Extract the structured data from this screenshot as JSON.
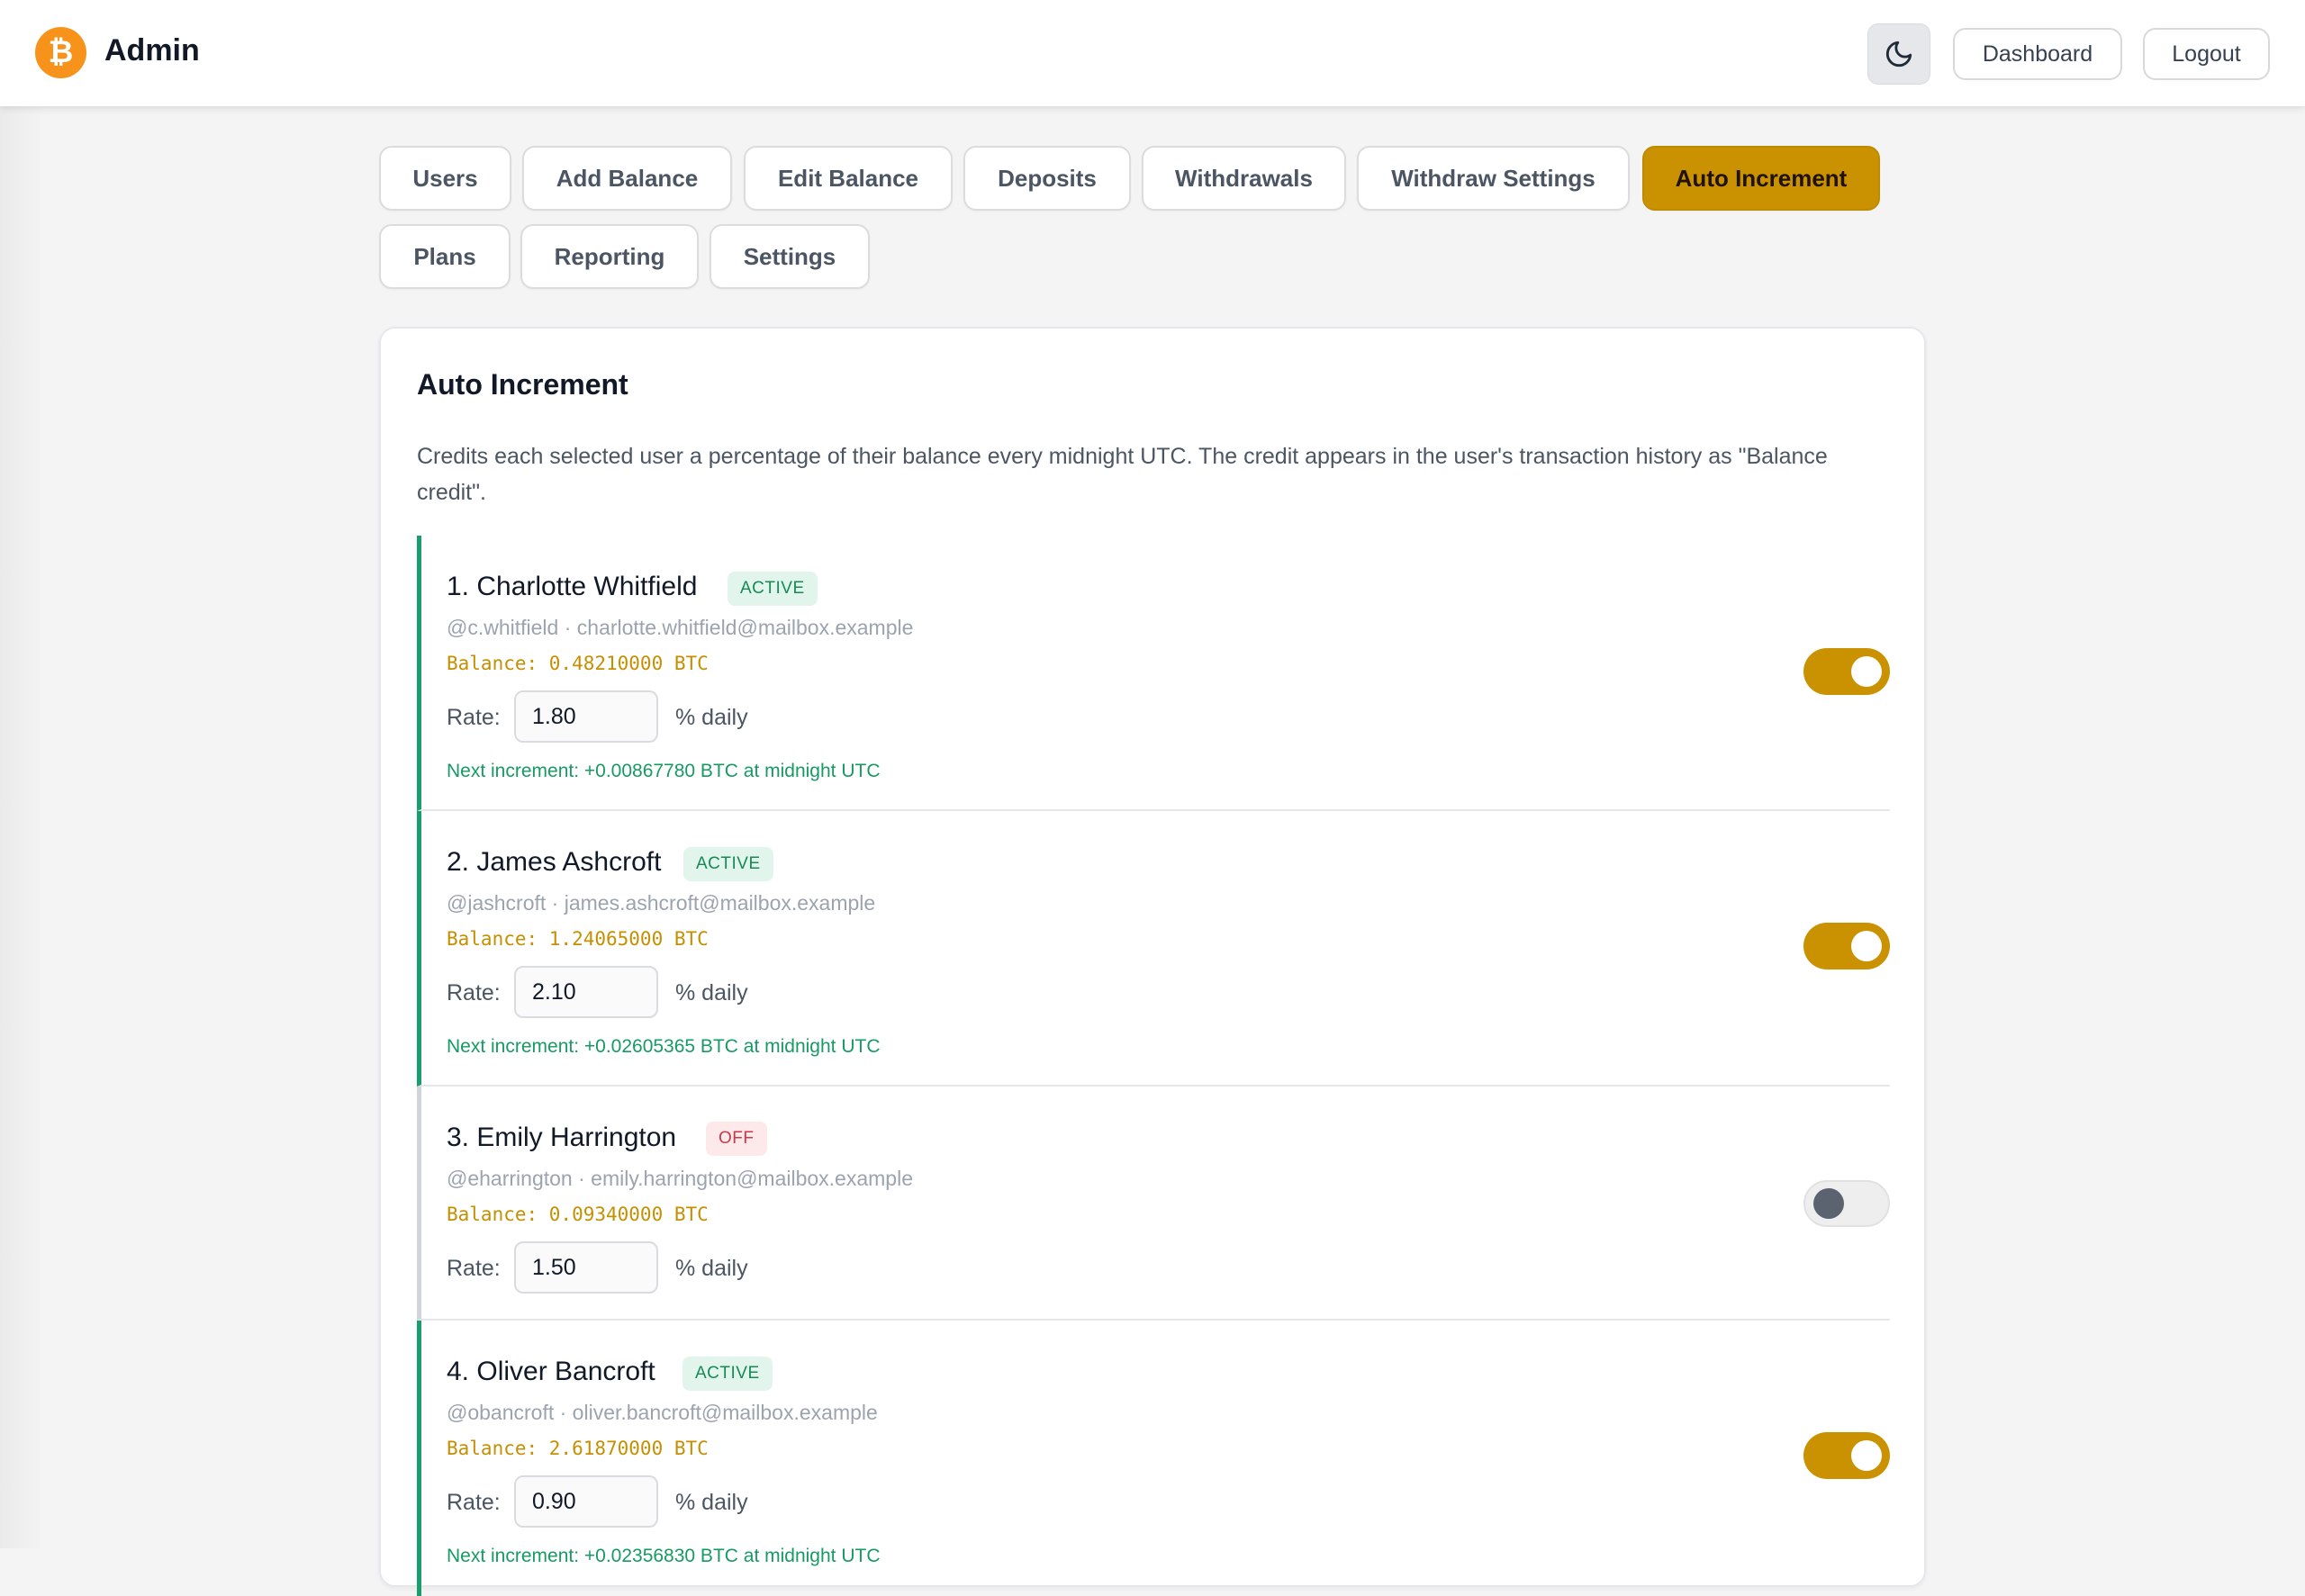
{
  "header": {
    "brand_icon": "bitcoin-icon",
    "brand_symbol": "₿",
    "title": "Admin",
    "theme_icon": "moon-icon",
    "dashboard_label": "Dashboard",
    "logout_label": "Logout"
  },
  "tabs": [
    {
      "label": "Users"
    },
    {
      "label": "Add Balance"
    },
    {
      "label": "Edit Balance"
    },
    {
      "label": "Deposits"
    },
    {
      "label": "Withdrawals"
    },
    {
      "label": "Withdraw Settings"
    },
    {
      "label": "Auto Increment",
      "active": true
    },
    {
      "label": "Plans"
    },
    {
      "label": "Reporting"
    },
    {
      "label": "Settings"
    }
  ],
  "panel": {
    "title": "Auto Increment",
    "description": "Credits each selected user a percentage of their balance every midnight UTC. The credit appears in the user's transaction history as \"Balance credit\"."
  },
  "colors": {
    "accent": "#ca9100",
    "active_green": "#1a9e6f",
    "off_red": "#c73a4b",
    "bitcoin_orange": "#f7931a"
  },
  "users": [
    {
      "name": "1. Charlotte Whitfield",
      "status": "ACTIVE",
      "meta": "@c.whitfield · charlotte.whitfield@mailbox.example",
      "balance": "Balance: 0.48210000 BTC",
      "rate_label": "Rate:",
      "rate": "1.80",
      "rate_unit": "% daily",
      "next": "Next increment: +0.00867780 BTC at midnight UTC",
      "enabled": true
    },
    {
      "name": "2. James Ashcroft",
      "status": "ACTIVE",
      "meta": "@jashcroft · james.ashcroft@mailbox.example",
      "balance": "Balance: 1.24065000 BTC",
      "rate_label": "Rate:",
      "rate": "2.10",
      "rate_unit": "% daily",
      "next": "Next increment: +0.02605365 BTC at midnight UTC",
      "enabled": true
    },
    {
      "name": "3. Emily Harrington",
      "status": "OFF",
      "meta": "@eharrington · emily.harrington@mailbox.example",
      "balance": "Balance: 0.09340000 BTC",
      "rate_label": "Rate:",
      "rate": "1.50",
      "rate_unit": "% daily",
      "next": "",
      "enabled": false
    },
    {
      "name": "4. Oliver Bancroft",
      "status": "ACTIVE",
      "meta": "@obancroft · oliver.bancroft@mailbox.example",
      "balance": "Balance: 2.61870000 BTC",
      "rate_label": "Rate:",
      "rate": "0.90",
      "rate_unit": "% daily",
      "next": "Next increment: +0.02356830 BTC at midnight UTC",
      "enabled": true
    }
  ]
}
